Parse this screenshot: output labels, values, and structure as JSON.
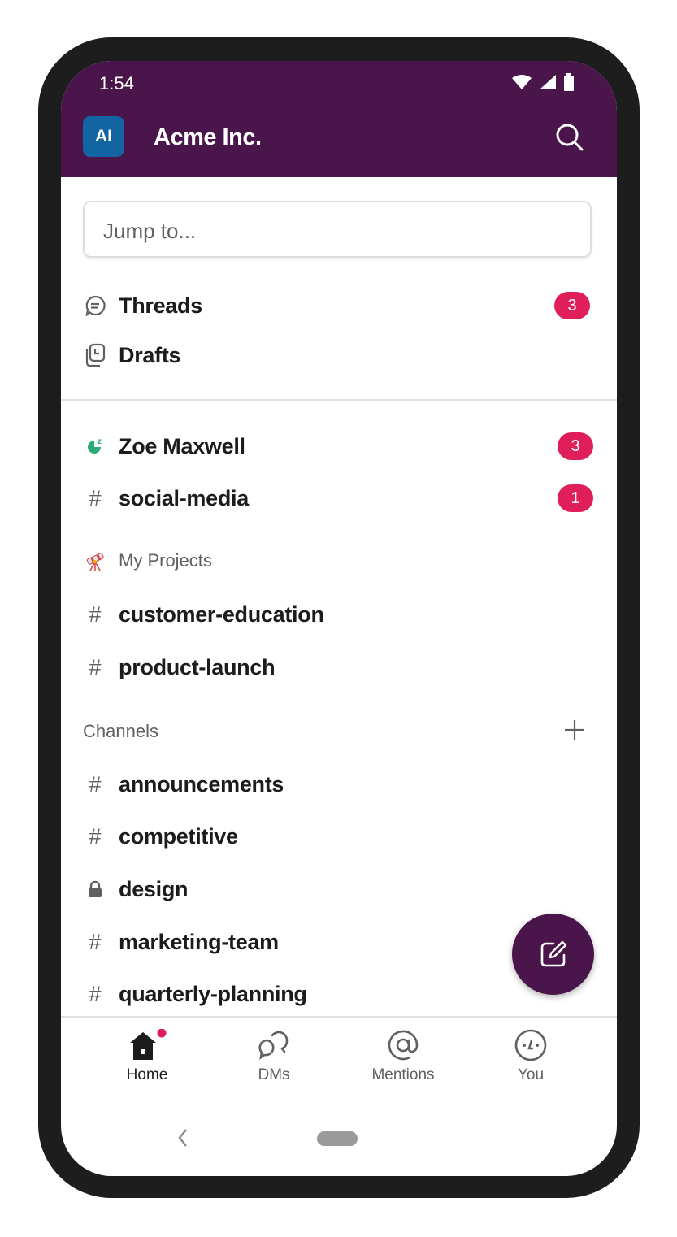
{
  "status_bar": {
    "time": "1:54",
    "icons": [
      "wifi-icon",
      "signal-icon",
      "battery-icon"
    ]
  },
  "header": {
    "workspace_initials": "AI",
    "workspace_name": "Acme Inc.",
    "search_icon": "search-icon",
    "color": "#4a154b",
    "avatar_color": "#1264a3"
  },
  "jump_to": {
    "placeholder": "Jump to..."
  },
  "quick_links": [
    {
      "icon": "threads-icon",
      "label": "Threads",
      "badge": "3"
    },
    {
      "icon": "drafts-icon",
      "label": "Drafts",
      "badge": null
    }
  ],
  "unreads": [
    {
      "icon": "away-status-icon",
      "label": "Zoe Maxwell",
      "badge": "3"
    },
    {
      "icon": "hash-icon",
      "label": "social-media",
      "badge": "1"
    }
  ],
  "my_projects": {
    "icon": "telescope-emoji-icon",
    "title": "My Projects",
    "items": [
      {
        "icon": "hash-icon",
        "label": "customer-education"
      },
      {
        "icon": "hash-icon",
        "label": "product-launch"
      }
    ]
  },
  "channels": {
    "title": "Channels",
    "add_icon": "plus-icon",
    "items": [
      {
        "icon": "hash-icon",
        "label": "announcements"
      },
      {
        "icon": "hash-icon",
        "label": "competitive"
      },
      {
        "icon": "lock-icon",
        "label": "design"
      },
      {
        "icon": "hash-icon",
        "label": "marketing-team"
      },
      {
        "icon": "hash-icon",
        "label": "quarterly-planning"
      }
    ]
  },
  "fab": {
    "icon": "compose-icon"
  },
  "tabbar": [
    {
      "icon": "home-icon",
      "label": "Home",
      "active": true,
      "dot": true
    },
    {
      "icon": "dms-icon",
      "label": "DMs",
      "active": false
    },
    {
      "icon": "mentions-icon",
      "label": "Mentions",
      "active": false
    },
    {
      "icon": "you-icon",
      "label": "You",
      "active": false
    }
  ],
  "badge_color": "#e01e5a"
}
